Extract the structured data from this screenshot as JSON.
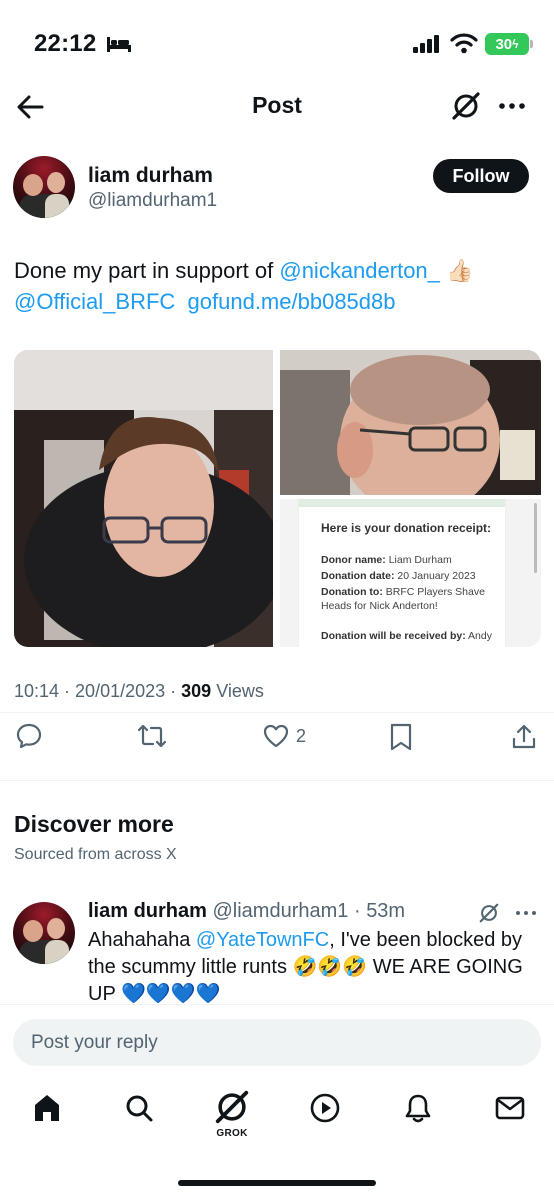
{
  "status_bar": {
    "time": "22:12",
    "battery": "30"
  },
  "header": {
    "title": "Post"
  },
  "post": {
    "author_name": "liam durham",
    "author_handle": "@liamdurham1",
    "follow_label": "Follow",
    "text_before": "Done my part in support of ",
    "mention1": "@nickanderton_",
    "emoji": "👍🏻",
    "mention2": "@Official_BRFC",
    "link": "gofund.me/bb085d8b",
    "media": {
      "receipt": {
        "title": "Here is your donation receipt:",
        "donor_label": "Donor name:",
        "donor_value": "Liam Durham",
        "date_label": "Donation date:",
        "date_value": "20 January 2023",
        "to_label": "Donation to:",
        "to_value": "BRFC Players Shave Heads for Nick Anderton!",
        "received_label": "Donation will be received by:",
        "received_value": "Andy"
      }
    },
    "time": "10:14",
    "date": "20/01/2023",
    "views_count": "309",
    "views_label": "Views",
    "like_count": "2"
  },
  "discover": {
    "title": "Discover more",
    "subtitle": "Sourced from across X"
  },
  "recommended": {
    "author_name": "liam durham",
    "author_handle": "@liamdurham1",
    "age": "53m",
    "text_before": "Ahahahaha ",
    "mention": "@YateTownFC",
    "text_after": ", I've been blocked by the scummy little runts 🤣🤣🤣 WE ARE GOING UP 💙💙💙💙"
  },
  "reply": {
    "placeholder": "Post your reply"
  },
  "tab_bar": {
    "grok_label": "GROK"
  },
  "colors": {
    "accent": "#1d9bf0",
    "text": "#0f1419",
    "secondary": "#536471",
    "battery": "#34c759"
  }
}
